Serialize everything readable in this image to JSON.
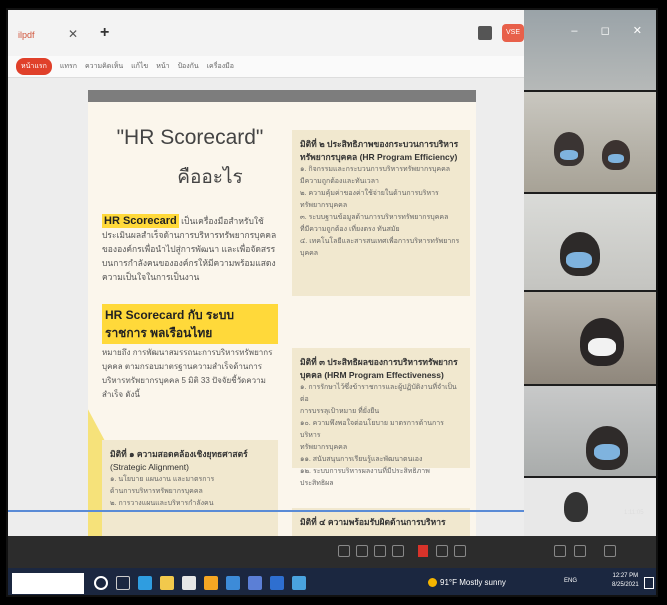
{
  "browser": {
    "tab_title": "ilpdf",
    "close_glyph": "✕",
    "new_tab_glyph": "+",
    "badge": "VSE"
  },
  "menu": {
    "items": [
      "หน้าแรก",
      "แทรก",
      "ความคิดเห็น",
      "แก้ไข",
      "หน้า",
      "ป้องกัน",
      "เครื่องมือ"
    ]
  },
  "document": {
    "title": "\"HR Scorecard\"",
    "subtitle": "คืออะไร",
    "intro_highlight": "HR Scorecard",
    "intro_text": "เป็นเครื่องมือสำหรับใช้ประเมินผลสำเร็จด้านการบริหารทรัพยากรบุคคลขององค์กรเพื่อนำไปสู่การพัฒนา และเพื่อจัดสรรบนการกำลังคนขององค์กรให้มีความพร้อมแสดงความเป็นใจในการเป็นงาน",
    "section2_highlight": "HR Scorecard กับ ระบบราชการ พลเรือนไทย",
    "section2_text": "หมายถึง การพัฒนาสมรรถนะการบริหารทรัพยากรบุคคล ตามกรอบมาตรฐานความสำเร็จด้านการบริหารทรัพยากรบุคคล 5 มิติ 33 ปัจจัยชี้วัดความสำเร็จ ดังนี้",
    "box_left_title": "มิติที่ ๑ ความสอดคล้องเชิงยุทธศาสตร์",
    "box_left_sub": "(Strategic Alignment)",
    "box_left_lines": [
      "๑. นโยบาย แผนงาน และมาตรการ",
      "ด้านการบริหารทรัพยากรบุคคล",
      "๒. การวางแผนและบริหารกำลังคน"
    ],
    "box1_title": "มิติที่ ๒ ประสิทธิภาพของกระบวนการบริหารทรัพยากรบุคคล (HR Program Efficiency)",
    "box1_lines": [
      "๑. กิจกรรมและกระบวนการบริหารทรัพยากรบุคคล",
      "มีความถูกต้องและทันเวลา",
      "๒. ความคุ้มค่าของค่าใช้จ่ายในด้านการบริหาร",
      "ทรัพยากรบุคคล",
      "๓. ระบบฐานข้อมูลด้านการบริหารทรัพยากรบุคคล",
      "ที่มีความถูกต้อง เที่ยงตรง ทันสมัย",
      "๔. เทคโนโลยีและสารสนเทศเพื่อการบริหารทรัพยากร",
      "บุคคล"
    ],
    "box2_title": "มิติที่ ๓ ประสิทธิผลของการบริหารทรัพยากรบุคคล (HRM Program Effectiveness)",
    "box2_lines": [
      "๑. การรักษาไว้ซึ่งข้าราชการและผู้ปฏิบัติงานที่จำเป็นต่อ",
      "การบรรลุเป้าหมาย ที่ยั่งยืน",
      "๑๐. ความพึงพอใจต่อนโยบาย มาตรการด้านการบริหาร",
      "ทรัพยากรบุคคล",
      "๑๑. สนับสนุนการเรียนรู้และพัฒนาตนเอง",
      "๑๒. ระบบการบริหารผลงานที่มีประสิทธิภาพ ประสิทธิผล"
    ],
    "box3_title": "มิติที่ ๔ ความพร้อมรับผิดด้านการบริหาร"
  },
  "video": {
    "window_controls": "– ◻ ✕",
    "duration": "1:11:05"
  },
  "taskbar": {
    "weather": "91°F  Mostly sunny",
    "lang": "ENG",
    "time": "12:27 PM",
    "date": "8/25/2021"
  },
  "colors": {
    "accent_red": "#e0402a",
    "highlight_yellow": "#ffd93a",
    "page_bg": "#fbf6ec",
    "taskbar_bg": "#1b2740"
  }
}
